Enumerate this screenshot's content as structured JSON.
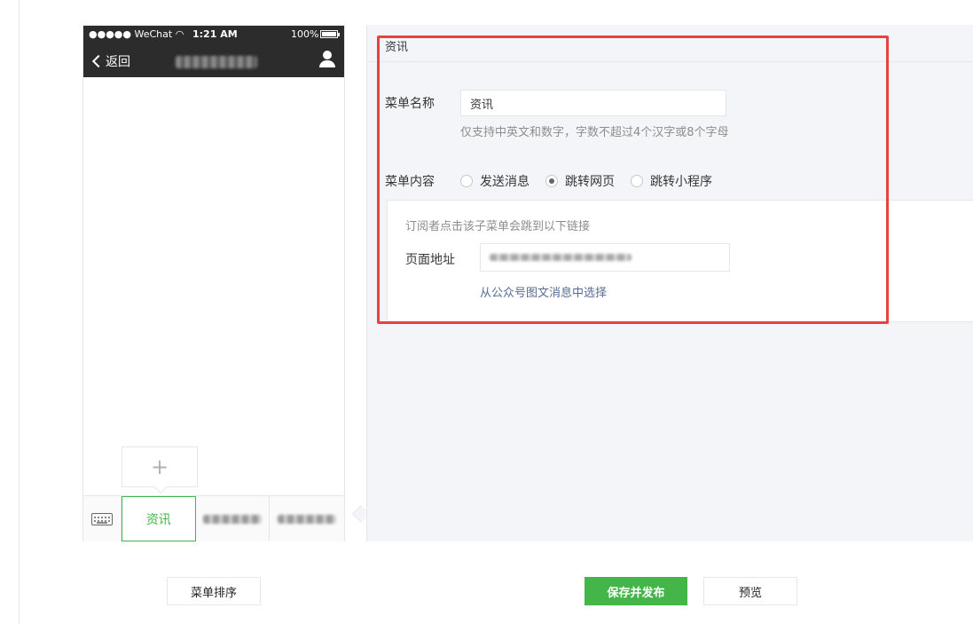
{
  "phone": {
    "carrier": "●●●●● WeChat",
    "time": "1:21 AM",
    "battery": "100%",
    "battery_level": 1.0,
    "back_label": "返回",
    "add_symbol": "+",
    "menu": {
      "active_tab": "资讯"
    }
  },
  "editor": {
    "title": "资讯",
    "name_label": "菜单名称",
    "name_value": "资讯",
    "name_hint": "仅支持中英文和数字，字数不超过4个汉字或8个字母",
    "content_label": "菜单内容",
    "content_options": [
      "发送消息",
      "跳转网页",
      "跳转小程序"
    ],
    "selected_option": "跳转网页",
    "link_hint": "订阅者点击该子菜单会跳到以下链接",
    "url_label": "页面地址",
    "pick_link": "从公众号图文消息中选择"
  },
  "buttons": {
    "sort": "菜单排序",
    "save_publish": "保存并发布",
    "preview": "预览"
  },
  "colors": {
    "accent_green": "#44b549",
    "highlight_red": "#e64340",
    "link_blue": "#576b95"
  },
  "icons": [
    "wifi-icon",
    "battery-icon",
    "back-chevron-icon",
    "user-icon",
    "keyboard-icon",
    "plus-icon"
  ]
}
